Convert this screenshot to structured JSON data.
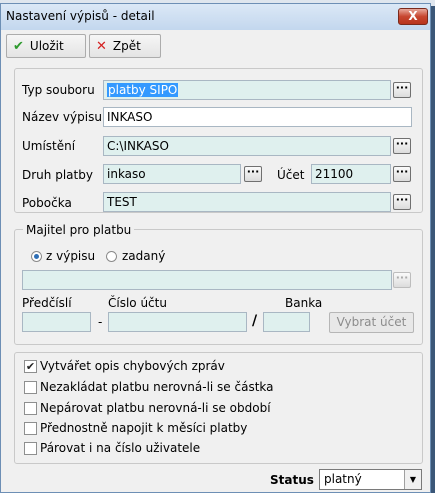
{
  "window": {
    "title": "Nastavení výpisů - detail",
    "close_label": "X"
  },
  "toolbar": {
    "save_label": "Uložit",
    "back_label": "Zpět"
  },
  "form": {
    "typ_souboru": {
      "label": "Typ souboru",
      "value": "platby SIPO"
    },
    "nazev_vypisu": {
      "label": "Název výpisu",
      "value": "INKASO"
    },
    "umisteni": {
      "label": "Umístění",
      "value": "C:\\INKASO"
    },
    "druh_platby": {
      "label": "Druh platby",
      "value": "inkaso"
    },
    "ucet": {
      "label": "Účet",
      "value": "21100"
    },
    "pobocka": {
      "label": "Pobočka",
      "value": "TEST"
    },
    "browse": "···"
  },
  "majitel": {
    "legend": "Majitel pro platbu",
    "radio_from_statement": "z výpisu",
    "radio_entered": "zadaný",
    "selected": "z výpisu",
    "account_value": "",
    "predcisli_label": "Předčíslí",
    "predcisli_value": "",
    "cislo_uctu_label": "Číslo účtu",
    "cislo_uctu_value": "",
    "banka_label": "Banka",
    "banka_value": "",
    "dash": "-",
    "slash": "/",
    "vybrat_ucet_label": "Vybrat účet"
  },
  "options": [
    {
      "label": "Vytvářet opis chybových zpráv",
      "checked": true
    },
    {
      "label": "Nezakládat platbu nerovná-li se částka",
      "checked": false
    },
    {
      "label": "Nepárovat platbu nerovná-li se období",
      "checked": false
    },
    {
      "label": "Přednostně napojit k měsíci platby",
      "checked": false
    },
    {
      "label": "Párovat i na číslo uživatele",
      "checked": false
    }
  ],
  "status": {
    "label": "Status",
    "value": "platný"
  },
  "icons": {
    "save": "check-icon",
    "back": "cross-icon"
  },
  "colors": {
    "field_teal": "#dff0ee",
    "save_icon": "#2e9a2e",
    "back_icon": "#d42020",
    "selection": "#3399ff"
  }
}
